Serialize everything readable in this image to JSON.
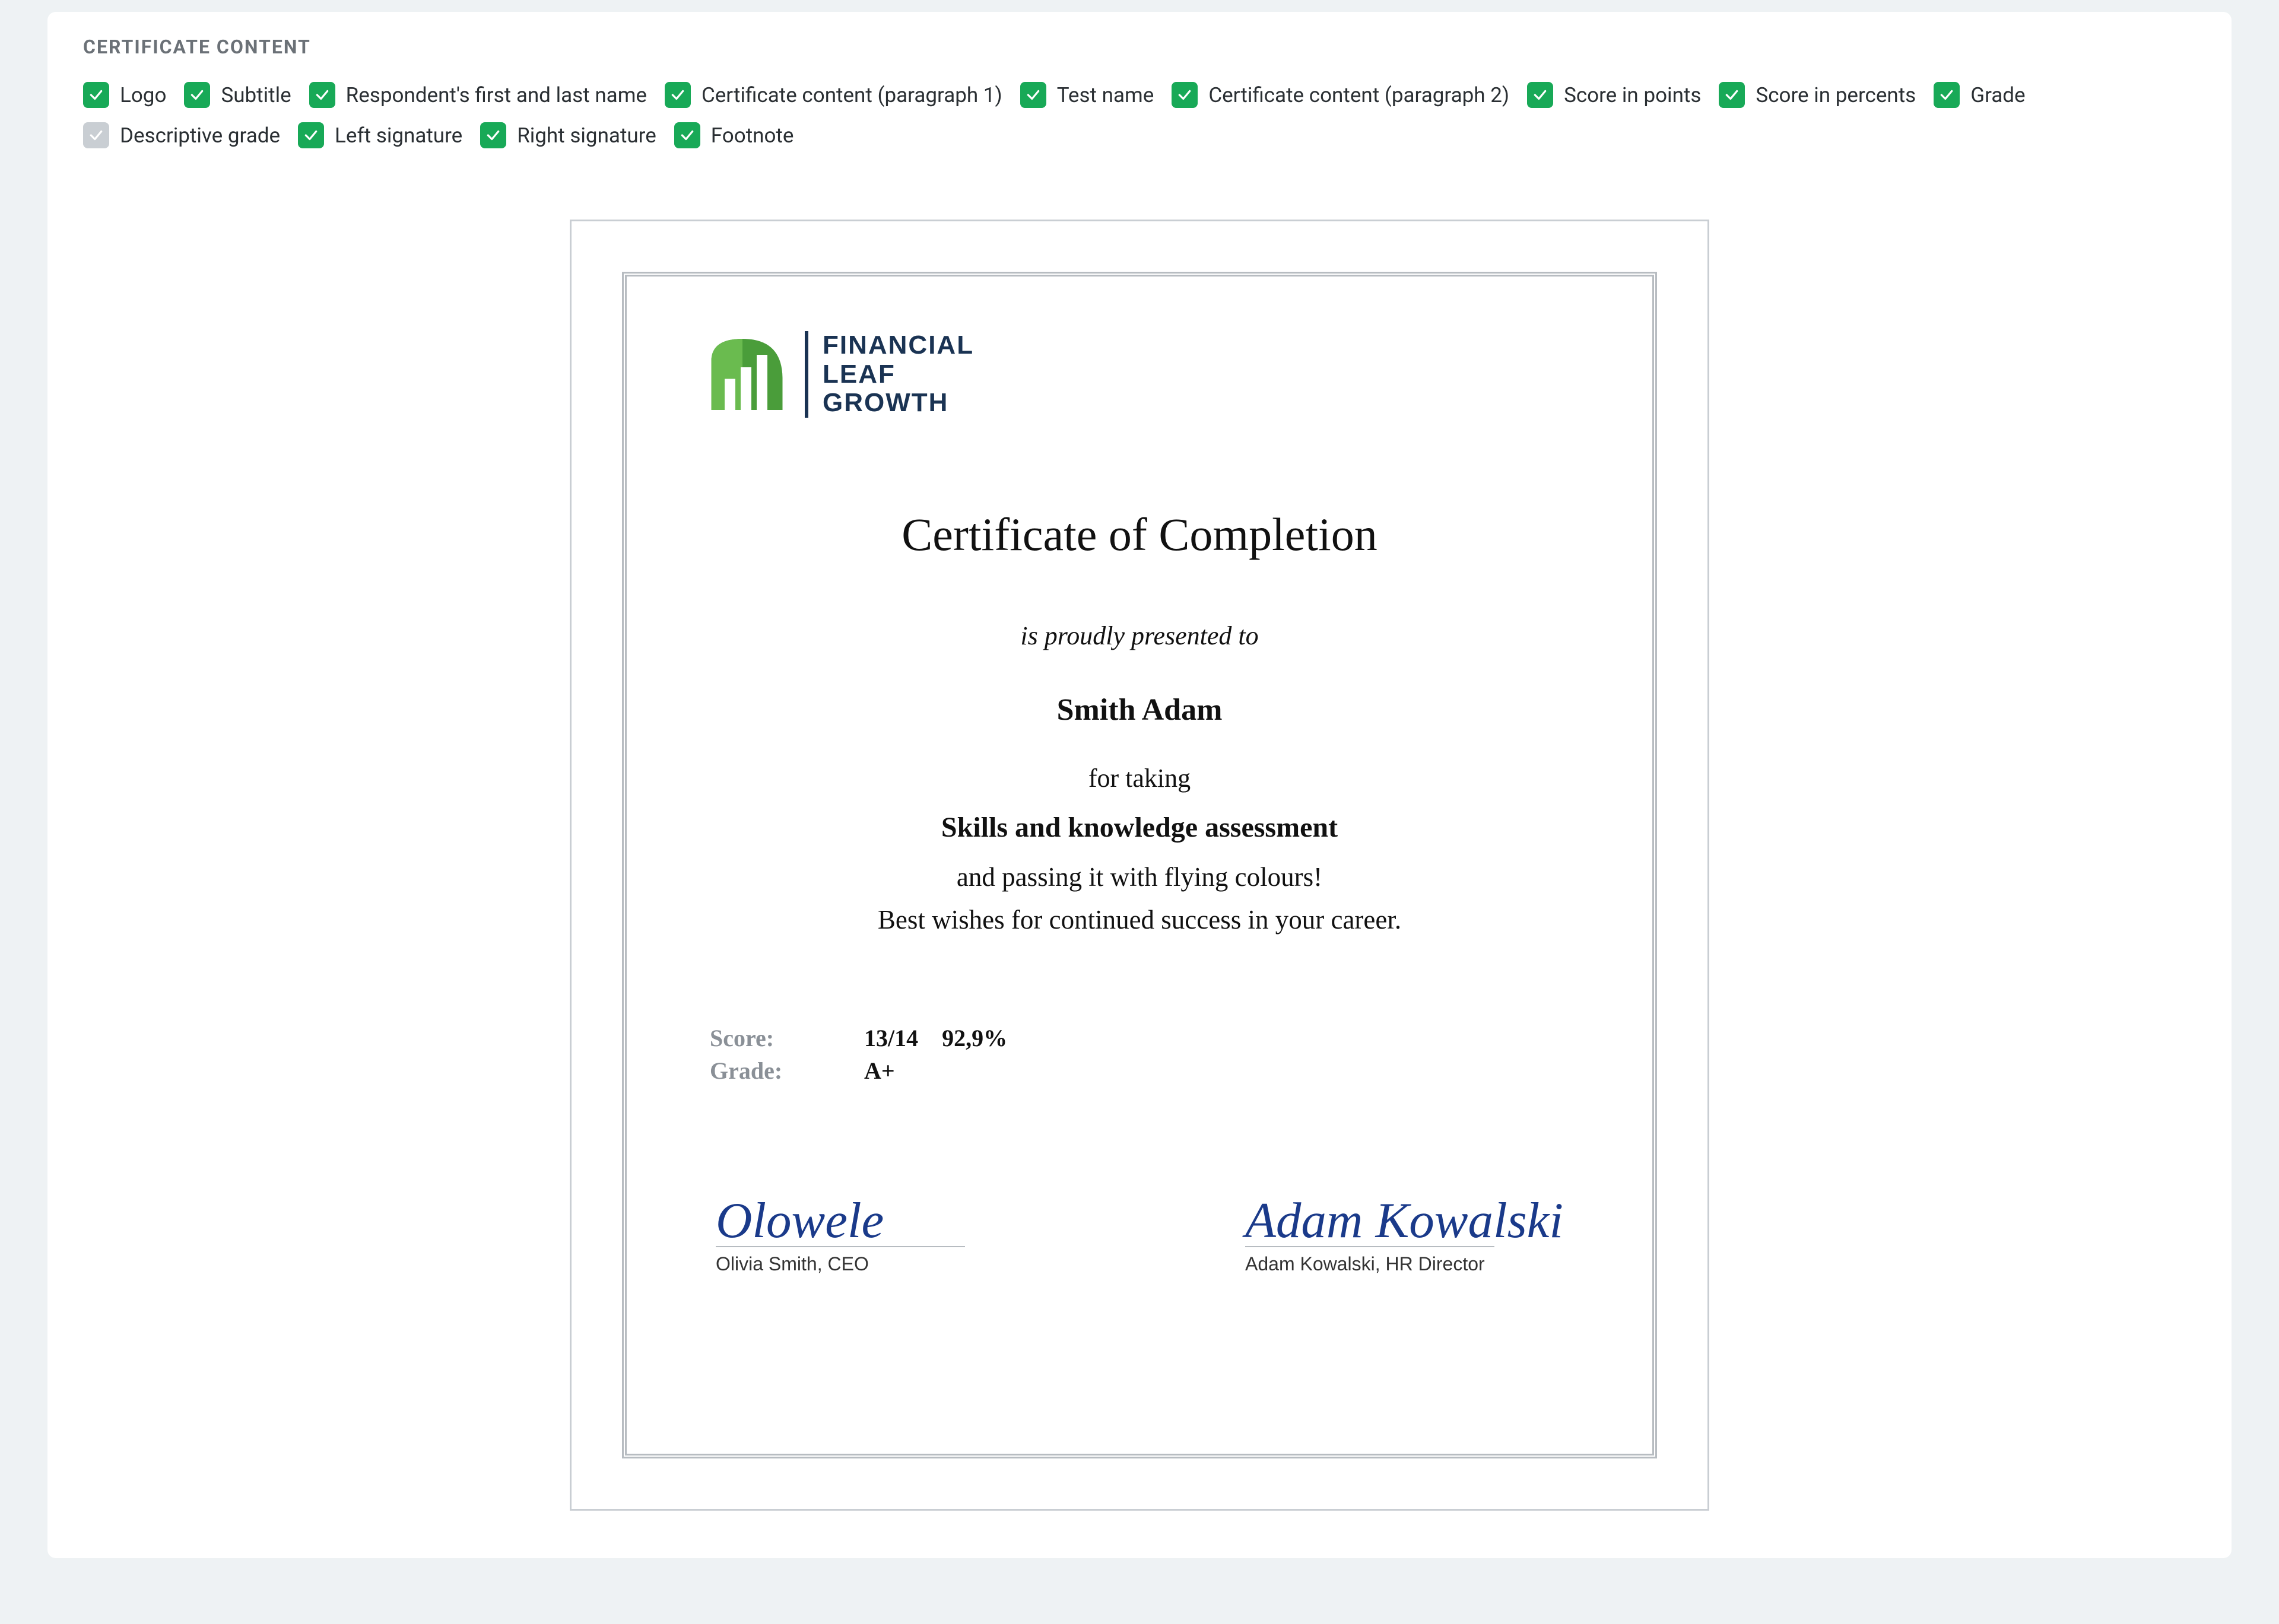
{
  "section_heading": "CERTIFICATE CONTENT",
  "checkboxes": [
    {
      "key": "logo",
      "label": "Logo",
      "checked": true
    },
    {
      "key": "subtitle",
      "label": "Subtitle",
      "checked": true
    },
    {
      "key": "respondent-name",
      "label": "Respondent's first and last name",
      "checked": true
    },
    {
      "key": "cert-para-1",
      "label": "Certificate content (paragraph 1)",
      "checked": true
    },
    {
      "key": "test-name",
      "label": "Test name",
      "checked": true
    },
    {
      "key": "cert-para-2",
      "label": "Certificate content (paragraph 2)",
      "checked": true
    },
    {
      "key": "score-points",
      "label": "Score in points",
      "checked": true
    },
    {
      "key": "score-percent",
      "label": "Score in percents",
      "checked": true
    },
    {
      "key": "grade",
      "label": "Grade",
      "checked": true
    },
    {
      "key": "descriptive-grade",
      "label": "Descriptive grade",
      "checked": false
    },
    {
      "key": "left-signature",
      "label": "Left signature",
      "checked": true
    },
    {
      "key": "right-signature",
      "label": "Right signature",
      "checked": true
    },
    {
      "key": "footnote",
      "label": "Footnote",
      "checked": true
    }
  ],
  "logo_text": {
    "line1": "FINANCIAL",
    "line2": "LEAF",
    "line3": "GROWTH"
  },
  "cert": {
    "title": "Certificate of Completion",
    "subtitle": "is proudly presented to",
    "respondent_name": "Smith Adam",
    "para1": "for taking",
    "test_name": "Skills and knowledge assessment",
    "para2_a": "and passing it with flying colours!",
    "para2_b": "Best wishes for continued success in your career.",
    "score_label": "Score:",
    "score_points": "13/14",
    "score_percent": "92,9%",
    "grade_label": "Grade:",
    "grade_value": "A+",
    "sig_left_script": "Olowele",
    "sig_left_caption": "Olivia Smith, CEO",
    "sig_right_script": "Adam Kowalski",
    "sig_right_caption": "Adam Kowalski, HR Director"
  }
}
